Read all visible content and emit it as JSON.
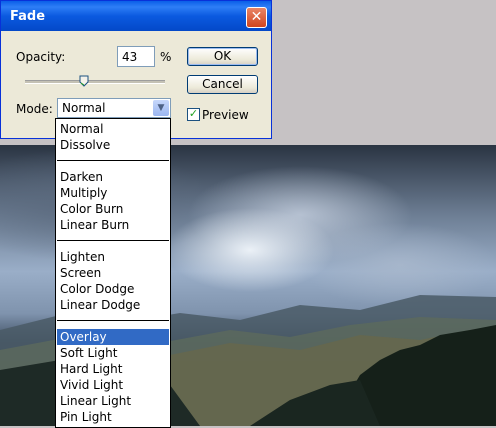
{
  "dialog": {
    "title": "Fade",
    "close_label": "✕",
    "opacity_label": "Opacity:",
    "opacity_value": "43",
    "opacity_unit": "%",
    "opacity_slider_level": 0.43,
    "ok_label": "OK",
    "cancel_label": "Cancel",
    "mode_label": "Mode:",
    "mode_value": "Normal",
    "preview_label": "Preview",
    "preview_checked": true
  },
  "dropdown": {
    "groups": [
      [
        "Normal",
        "Dissolve"
      ],
      [
        "Darken",
        "Multiply",
        "Color Burn",
        "Linear Burn"
      ],
      [
        "Lighten",
        "Screen",
        "Color Dodge",
        "Linear Dodge"
      ],
      [
        "Overlay",
        "Soft Light",
        "Hard Light",
        "Vivid Light",
        "Linear Light",
        "Pin Light"
      ]
    ],
    "highlighted": "Overlay"
  },
  "colors": {
    "titlebar": "#0a5ee8",
    "selection": "#316ac5",
    "dialog_face": "#ece9d8"
  }
}
